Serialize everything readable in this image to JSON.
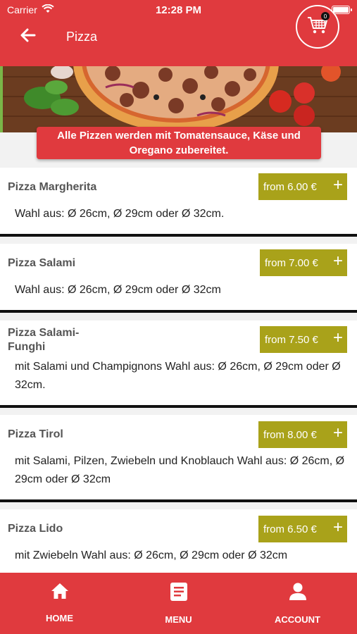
{
  "status_bar": {
    "carrier": "Carrier",
    "time": "12:28 PM"
  },
  "header": {
    "title": "Pizza",
    "cart_count": "0"
  },
  "info": {
    "line1": "Alle Pizzen werden mit Tomatensauce, Käse und",
    "line2": "Oregano zubereitet."
  },
  "items": [
    {
      "name": "Pizza Margherita",
      "price": "from 6.00 €",
      "desc": "Wahl aus: Ø 26cm, Ø 29cm oder Ø 32cm."
    },
    {
      "name": "Pizza Salami",
      "price": "from 7.00 €",
      "desc": "Wahl aus: Ø 26cm, Ø 29cm oder Ø 32cm"
    },
    {
      "name": "Pizza Salami-Funghi",
      "name_line1": "Pizza Salami-",
      "name_line2": "Funghi",
      "price": "from 7.50 €",
      "desc": "mit Salami und Champignons  Wahl aus: Ø 26cm, Ø 29cm oder Ø 32cm."
    },
    {
      "name": "Pizza Tirol",
      "price": "from 8.00 €",
      "desc": "mit Salami, Pilzen, Zwiebeln und Knoblauch  Wahl aus: Ø 26cm, Ø 29cm oder Ø 32cm"
    },
    {
      "name": "Pizza Lido",
      "price": "from 6.50 €",
      "desc": "mit Zwiebeln  Wahl aus: Ø 26cm, Ø 29cm oder Ø 32cm"
    }
  ],
  "plus_symbol": "+",
  "bottom_nav": {
    "home": "HOME",
    "menu": "MENU",
    "account": "ACCOUNT"
  },
  "colors": {
    "brand_red": "#e03a3e",
    "price_olive": "#a9a21a"
  },
  "icons": [
    "wifi-icon",
    "battery-icon",
    "back-arrow-icon",
    "cart-icon",
    "home-icon",
    "menu-icon",
    "account-icon"
  ]
}
